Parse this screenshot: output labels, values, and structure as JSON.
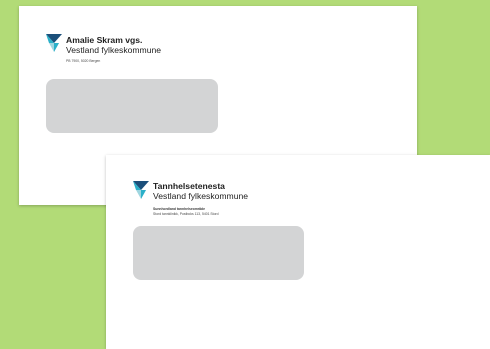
{
  "colors": {
    "background": "#b2db77",
    "envelope": "#ffffff",
    "address_window": "#d3d4d5",
    "logo_primary": "#1b4f7a",
    "logo_accent": "#2bb0c9",
    "logo_light": "#9fd6e0"
  },
  "envelopes": [
    {
      "logo_icon": "vestland-fylkeskommune-logo-icon",
      "org_name": "Amalie Skram vgs.",
      "org_sub": "Vestland fylkeskommune",
      "address_lines": [
        "PB 7900, 5020 Bergen"
      ]
    },
    {
      "logo_icon": "vestland-fylkeskommune-logo-icon",
      "org_name": "Tannhelsetenesta",
      "org_sub": "Vestland fylkeskommune",
      "address_lines": [
        "Sunnhordland tannhelseområde",
        "Stord tannklinikk, Postboks 113, 5401 Stord"
      ]
    }
  ]
}
